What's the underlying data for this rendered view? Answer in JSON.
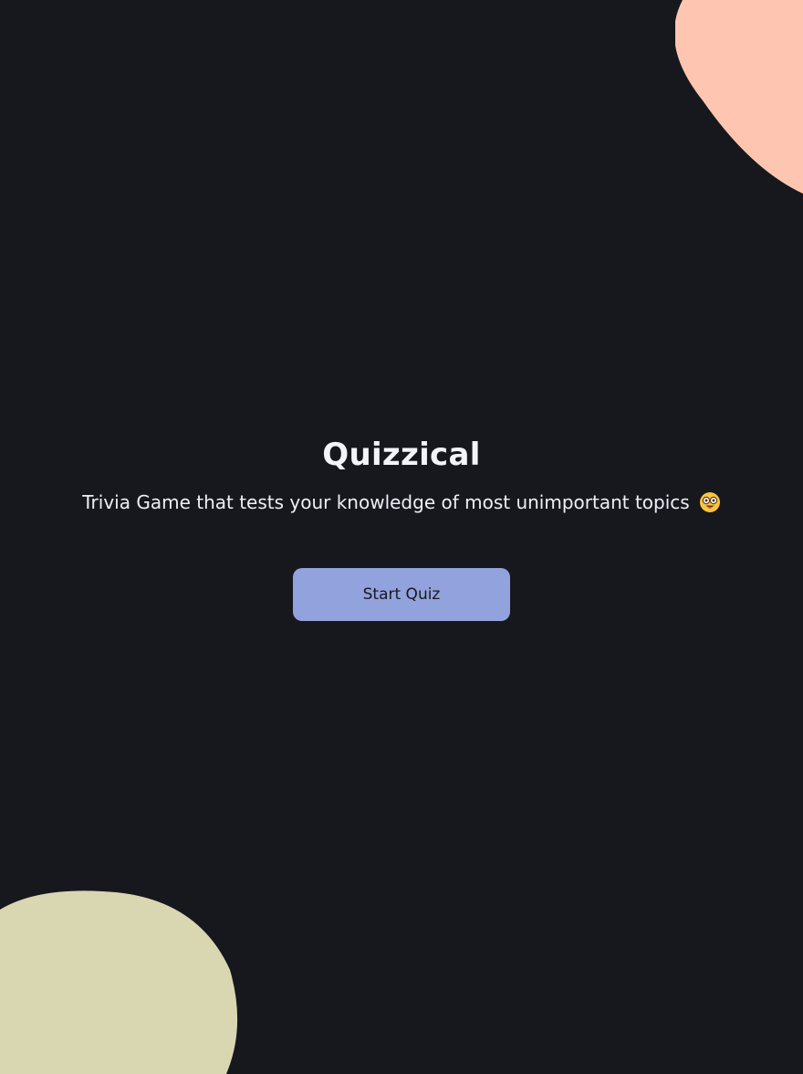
{
  "app": {
    "title": "Quizzical",
    "subtitle": "Trivia Game that tests your knowledge of most unimportant topics",
    "subtitle_emoji": "nerd-face-icon",
    "start_button_label": "Start Quiz"
  },
  "colors": {
    "background": "#17181e",
    "blob_top": "#fec6b0",
    "blob_bottom": "#d9d6b2",
    "button": "#92a2dd",
    "text": "#f3f4fa"
  }
}
